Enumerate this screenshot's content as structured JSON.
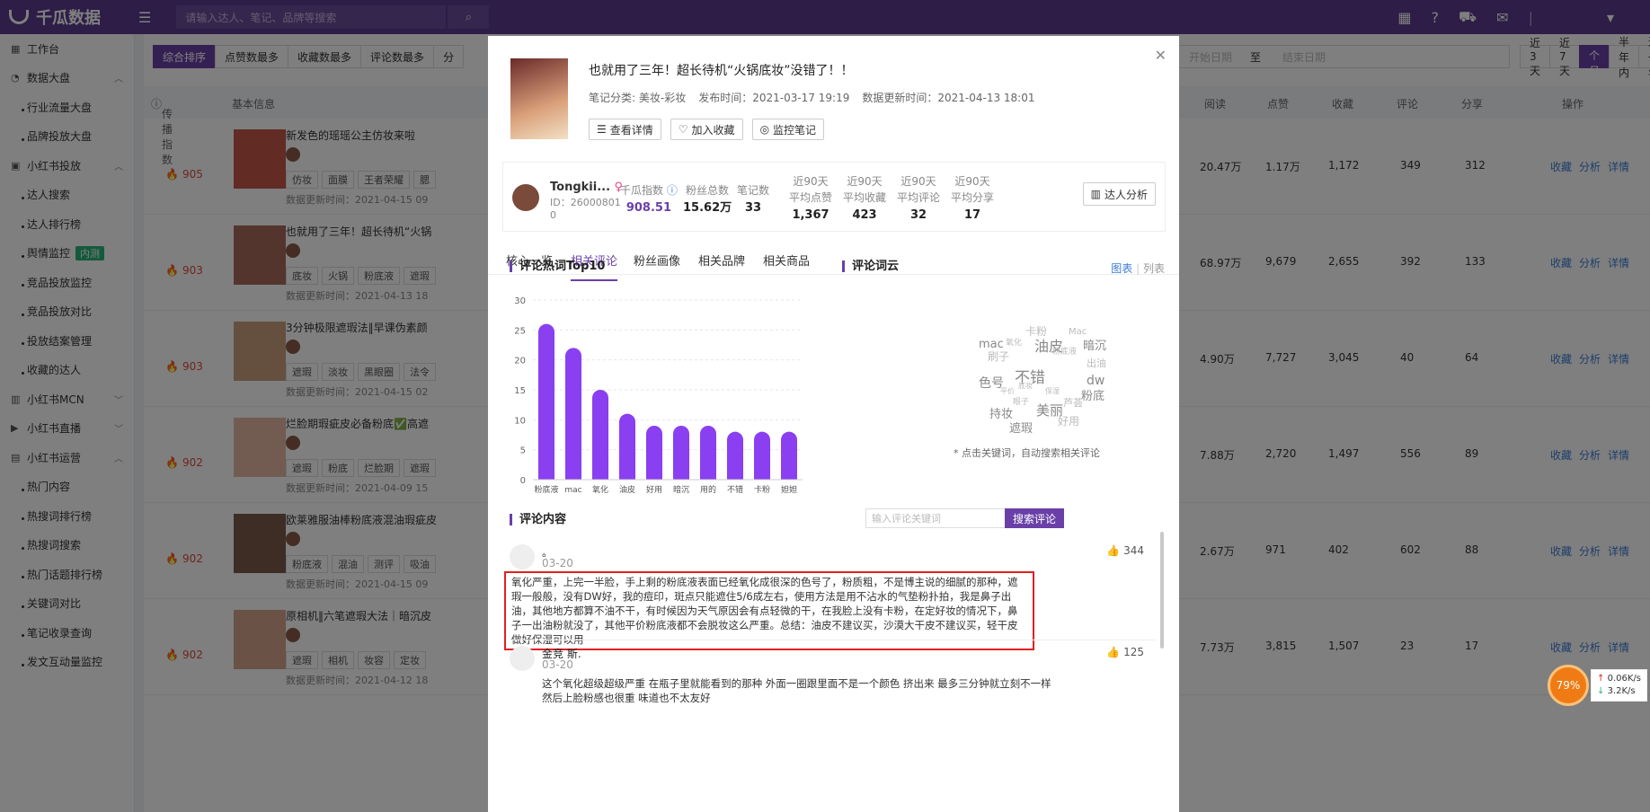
{
  "app": {
    "name": "千瓜数据",
    "search_placeholder": "请输入达人、笔记、品牌等搜索"
  },
  "sidebar": [
    {
      "label": "工作台",
      "type": "top",
      "icon": "grid-icon"
    },
    {
      "label": "数据大盘",
      "type": "group",
      "icon": "pie-icon"
    },
    {
      "label": "行业流量大盘",
      "type": "sub"
    },
    {
      "label": "品牌投放大盘",
      "type": "sub"
    },
    {
      "label": "小红书投放",
      "type": "group",
      "icon": "box-icon"
    },
    {
      "label": "达人搜索",
      "type": "sub"
    },
    {
      "label": "达人排行榜",
      "type": "sub"
    },
    {
      "label": "舆情监控",
      "type": "sub",
      "badge": "内测"
    },
    {
      "label": "竞品投放监控",
      "type": "sub"
    },
    {
      "label": "竞品投放对比",
      "type": "sub"
    },
    {
      "label": "投放结案管理",
      "type": "sub"
    },
    {
      "label": "收藏的达人",
      "type": "sub"
    },
    {
      "label": "小红书MCN",
      "type": "group",
      "icon": "chart-icon"
    },
    {
      "label": "小红书直播",
      "type": "group",
      "icon": "video-icon"
    },
    {
      "label": "小红书运营",
      "type": "group",
      "icon": "chat-icon"
    },
    {
      "label": "热门内容",
      "type": "sub"
    },
    {
      "label": "热搜词排行榜",
      "type": "sub"
    },
    {
      "label": "热搜词搜索",
      "type": "sub"
    },
    {
      "label": "热门话题排行榜",
      "type": "sub"
    },
    {
      "label": "关键词对比",
      "type": "sub"
    },
    {
      "label": "笔记收录查询",
      "type": "sub"
    },
    {
      "label": "发文互动量监控",
      "type": "sub"
    }
  ],
  "sort_tabs": [
    "综合排序",
    "点赞数最多",
    "收藏数最多",
    "评论数最多",
    "分"
  ],
  "date": {
    "start": "开始日期",
    "sep": "至",
    "end": "结束日期"
  },
  "range_tabs": [
    "近3天",
    "近7天",
    "1个月",
    "半年内",
    "近一年"
  ],
  "table_header": {
    "spread": "传播指数",
    "info": "基本信息",
    "read": "阅读",
    "like": "点赞",
    "fav": "收藏",
    "comment": "评论",
    "share": "分享",
    "ops": "操作"
  },
  "rows": [
    {
      "score": "905",
      "title": "新发色的瑶瑶公主仿妆来啦",
      "tags": [
        "仿妆",
        "面膜",
        "王者荣耀",
        "腮"
      ],
      "upd": "数据更新时间：2021-04-15 09",
      "read": "20.47万",
      "like": "1.17万",
      "fav": "1,172",
      "comment": "349",
      "share": "312"
    },
    {
      "score": "903",
      "title": "也就用了三年！超长待机“火锅",
      "tags": [
        "底妆",
        "火锅",
        "粉底液",
        "遮瑕"
      ],
      "upd": "数据更新时间：2021-04-13 18",
      "read": "68.97万",
      "like": "9,679",
      "fav": "2,655",
      "comment": "392",
      "share": "133"
    },
    {
      "score": "903",
      "title": "3分钟极限遮瑕法‖早课伪素颜",
      "tags": [
        "遮瑕",
        "淡妆",
        "黑眼圈",
        "法令"
      ],
      "upd": "数据更新时间：2021-04-15 02",
      "read": "4.90万",
      "like": "7,727",
      "fav": "3,045",
      "comment": "40",
      "share": "64"
    },
    {
      "score": "902",
      "title": "烂脸期瑕疵皮必备粉底✅高遮",
      "tags": [
        "遮瑕",
        "粉底",
        "烂脸期",
        "遮瑕"
      ],
      "upd": "数据更新时间：2021-04-09 15",
      "read": "7.88万",
      "like": "2,720",
      "fav": "1,497",
      "comment": "556",
      "share": "89"
    },
    {
      "score": "902",
      "title": "欧莱雅服油棒粉底液混油瑕疵皮",
      "tags": [
        "粉底液",
        "混油",
        "测评",
        "吸油"
      ],
      "upd": "数据更新时间：2021-04-15 09",
      "read": "2.67万",
      "like": "971",
      "fav": "402",
      "comment": "602",
      "share": "88"
    },
    {
      "score": "902",
      "title": "原相机‖六笔遮瑕大法｜暗沉皮",
      "tags": [
        "遮瑕",
        "相机",
        "妆容",
        "定妆"
      ],
      "upd": "数据更新时间：2021-04-12 18",
      "read": "7.73万",
      "like": "3,815",
      "fav": "1,507",
      "comment": "23",
      "share": "17"
    }
  ],
  "row_ops": [
    "收藏",
    "分析",
    "详情"
  ],
  "modal": {
    "title": "也就用了三年！超长待机“火锅底妆”没错了！！",
    "category": "笔记分类: 美妆-彩妆",
    "published": "发布时间：2021-03-17 19:19",
    "updated": "数据更新时间：2021-04-13 18:01",
    "buttons": [
      "查看详情",
      "加入收藏",
      "监控笔记"
    ],
    "creator": {
      "name": "Tongkii...",
      "id": "ID：26000801 0"
    },
    "stats": [
      {
        "label": "千瓜指数",
        "value": "908.51"
      },
      {
        "label": "粉丝总数",
        "value": "15.62万"
      },
      {
        "label": "笔记数",
        "value": "33"
      },
      {
        "label": "近90天 平均点赞",
        "value": "1,367"
      },
      {
        "label": "近90天 平均收藏",
        "value": "423"
      },
      {
        "label": "近90天 平均评论",
        "value": "32"
      },
      {
        "label": "近90天 平均分享",
        "value": "17"
      }
    ],
    "analysis_btn": "达人分析",
    "tabs": [
      "核心一览",
      "相关评论",
      "粉丝画像",
      "相关品牌",
      "相关商品"
    ],
    "hot_title": "评论热词Top10",
    "cloud_title": "评论词云",
    "view_chart": "图表",
    "view_list": "列表",
    "cloud_note": "* 点击关键词，自动搜索相关评论",
    "cloud_words": [
      "卡粉",
      "Mac",
      "mac",
      "油皮",
      "氧化",
      "暗沉",
      "刷子",
      "粉底液",
      "出油",
      "不错",
      "色号",
      "dw",
      "粉底",
      "美丽",
      "持妆",
      "芦荟",
      "遮瑕",
      "好用",
      "眼子",
      "保湿",
      "平价",
      "底妆"
    ],
    "comments_title": "评论内容",
    "comment_placeholder": "输入评论关键词",
    "comment_btn": "搜索评论",
    "comments": [
      {
        "name": "。",
        "date": "03-20",
        "likes": "344",
        "text": "氧化严重，上完一半脸，手上剩的粉底液表面已经氧化成很深的色号了，粉质粗，不是博主说的细腻的那种，遮瑕一般般，没有DW好，我的痘印，斑点只能遮住5/6成左右，使用方法是用不沾水的气垫粉扑拍，我是鼻子出油，其他地方都算不油不干，有时候因为天气原因会有点轻微的干，在我脸上没有卡粉，在定好妆的情况下，鼻子一出油粉就没了，其他平价粉底液都不会脱妆这么严重。总结：油皮不建议买，沙漠大干皮不建议买，轻干皮做好保湿可以用"
      },
      {
        "name": "金竞 斯.",
        "date": "03-20",
        "likes": "125",
        "text": "这个氧化超级超级严重 在瓶子里就能看到的那种 外面一圈跟里面不是一个颜色 挤出来 最多三分钟就立刻不一样 然后上脸粉感也很重 味道也不太友好"
      }
    ]
  },
  "chart_data": {
    "type": "bar",
    "title": "评论热词Top10",
    "categories": [
      "粉底液",
      "mac",
      "氧化",
      "油皮",
      "好用",
      "暗沉",
      "用的",
      "不错",
      "卡粉",
      "妲妲"
    ],
    "values": [
      26,
      22,
      15,
      11,
      9,
      9,
      9,
      8,
      8,
      8
    ],
    "ylim": [
      0,
      30
    ],
    "yticks": [
      0,
      5,
      10,
      15,
      20,
      25,
      30
    ],
    "bar_color": "#8a3ff0",
    "grid": true
  },
  "speed": {
    "percent": "79%",
    "up": "0.06K/s",
    "down": "3.2K/s"
  },
  "colors": {
    "brand": "#5b3a8e",
    "accent": "#6a40a8",
    "highlight": "#e02020"
  }
}
